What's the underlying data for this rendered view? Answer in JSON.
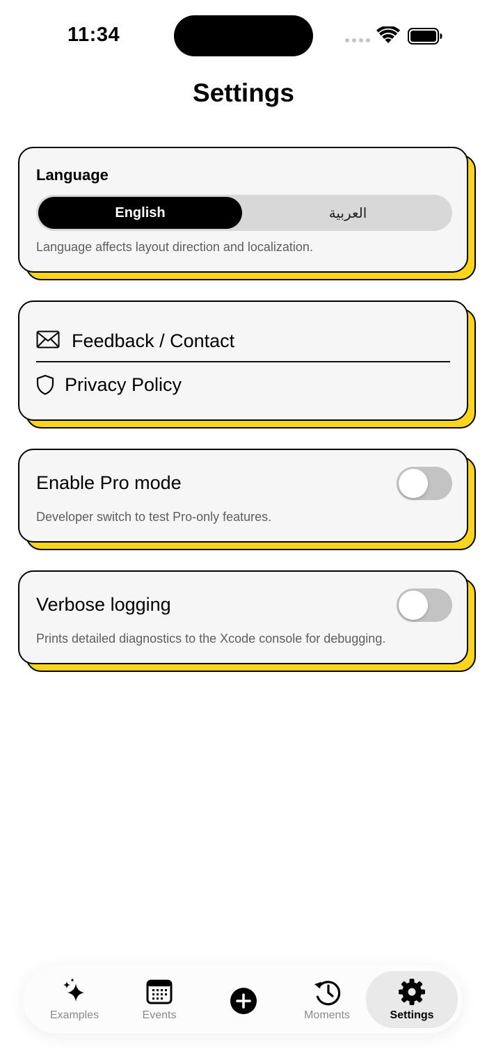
{
  "status_bar": {
    "time": "11:34"
  },
  "page": {
    "title": "Settings"
  },
  "language_card": {
    "title": "Language",
    "options": [
      "English",
      "العربية"
    ],
    "selected": "English",
    "note": "Language affects layout direction and localization."
  },
  "links_card": {
    "feedback_label": "Feedback / Contact",
    "privacy_label": "Privacy Policy"
  },
  "pro_mode": {
    "title": "Enable Pro mode",
    "note": "Developer switch to test Pro-only features.",
    "enabled": false
  },
  "verbose_logging": {
    "title": "Verbose logging",
    "note": "Prints detailed diagnostics to the Xcode console for debugging.",
    "enabled": false
  },
  "tabbar": {
    "items": [
      {
        "label": "Examples",
        "icon": "sparkles-icon"
      },
      {
        "label": "Events",
        "icon": "calendar-icon"
      },
      {
        "label": "",
        "icon": "plus-circle-icon"
      },
      {
        "label": "Moments",
        "icon": "history-icon"
      },
      {
        "label": "Settings",
        "icon": "gear-icon"
      }
    ],
    "active": "Settings"
  },
  "colors": {
    "accent_shadow": "#f9d51c",
    "card_bg": "#f6f6f6",
    "toggle_off": "#c3c3c3"
  }
}
